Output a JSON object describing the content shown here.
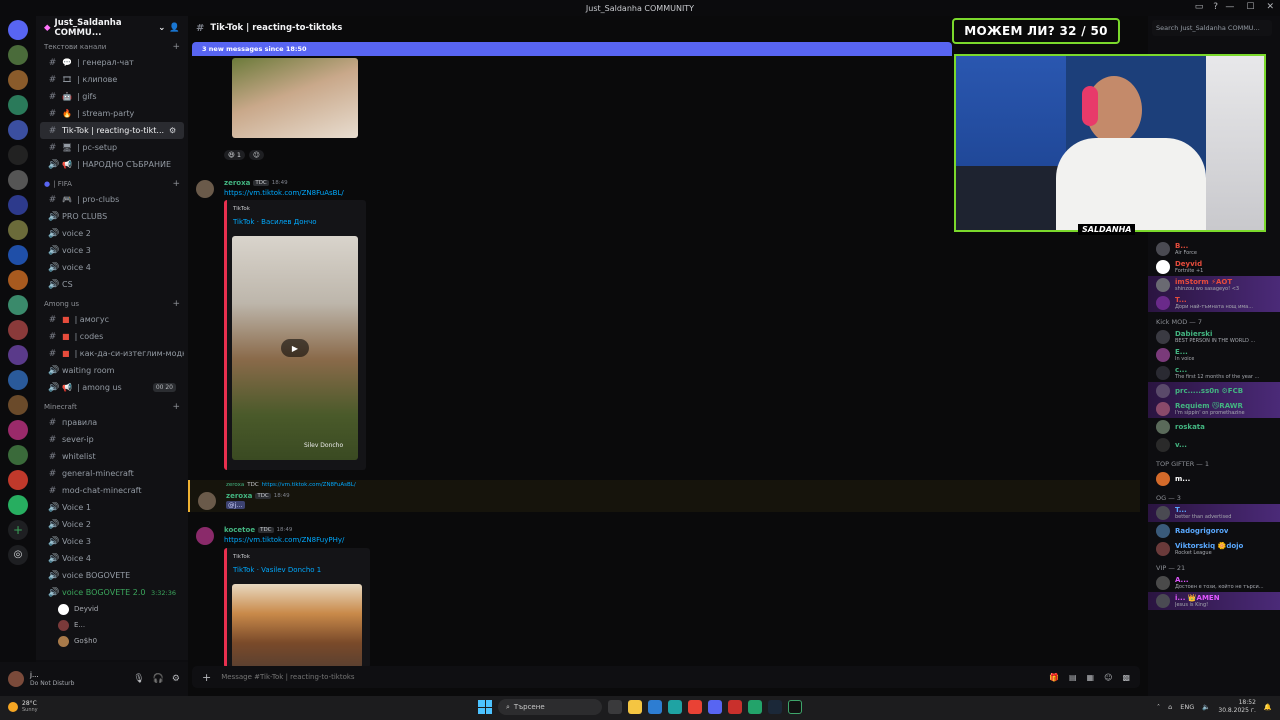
{
  "window": {
    "title": "Just_Saldanha COMMUNITY"
  },
  "server": {
    "name": "Just_Saldanha COMMU..."
  },
  "sidebar": {
    "categories": {
      "text": "Текстови канали",
      "fifa": "| FIFA",
      "among": "Among us",
      "minecraft": "Minecraft"
    },
    "channels_text": [
      "| генерал-чат",
      "| клипове",
      "| gifs",
      "| stream-party",
      "Tik-Tok | reacting-to-tikt...",
      "| pc-setup",
      "| НАРОДНО СЪБРАНИЕ"
    ],
    "channels_fifa": [
      "| pro-clubs",
      "PRO CLUBS",
      "voice 2",
      "voice 3",
      "voice 4",
      "CS"
    ],
    "channels_among": [
      "| амогус",
      "| codes",
      "| как-да-си-изтеглим-модн...",
      "waiting room",
      "| among us"
    ],
    "among_badge": "00 20",
    "channels_minecraft": [
      "правила",
      "sever-ip",
      "whitelist",
      "general-minecraft",
      "mod-chat-minecraft",
      "Voice 1",
      "Voice 2",
      "Voice 3",
      "Voice 4",
      "voice BOGOVETE",
      "voice BOGOVETE 2.0"
    ],
    "voice_timer": "3:32:36",
    "voice_users": [
      "Deyvid",
      "E...",
      "Go$h0"
    ]
  },
  "user": {
    "name": "j...",
    "status": "Do Not Disturb"
  },
  "channel": {
    "name": "Tik-Tok | reacting-to-tiktoks"
  },
  "new_messages": "3 new messages since 18:50",
  "messages": {
    "reaction_count": "1",
    "m1": {
      "author": "zeroxa",
      "tag": "TDC",
      "time": "18:49",
      "link": "https://vm.tiktok.com/ZN8FuAsBL/",
      "provider": "TikTok",
      "title": "TikTok · Василев Дончо",
      "watermark": "Silev Doncho"
    },
    "reply": {
      "ref_author": "zeroxa",
      "ref_tag": "TDC",
      "ref_link": "https://vm.tiktok.com/ZN8FuAsBL/",
      "author": "zeroxa",
      "tag": "TDC",
      "time": "18:49",
      "text": "@j..."
    },
    "m2": {
      "author": "kocetoe",
      "tag": "TDC",
      "time": "18:49",
      "link": "https://vm.tiktok.com/ZN8FuyPHy/",
      "provider": "TikTok",
      "title": "TikTok · Vasilev Doncho 1"
    }
  },
  "composer": {
    "placeholder": "Message #Tik-Tok | reacting-to-tiktoks"
  },
  "search": {
    "placeholder": "Search Just_Saldanha COMMU..."
  },
  "overlay": {
    "banner": "МОЖЕМ ЛИ? 32 / 50",
    "label": "SALDANHA"
  },
  "members": {
    "top": [
      {
        "name": "B...",
        "activity": "Air Force",
        "color": "#e74c3c"
      },
      {
        "name": "Deyvid",
        "activity": "Fortnite +1",
        "color": "#e74c3c"
      },
      {
        "name": "imStorm ⚡AOT",
        "activity": "shinzou wo sasageyo! <3",
        "color": "#e74c3c"
      },
      {
        "name": "T...",
        "activity": "Дори най-тъмната нощ има...",
        "color": "#e74c3c"
      }
    ],
    "kick_mod_title": "Kick MOD — 7",
    "kick_mod": [
      {
        "name": "Dabierski",
        "activity": "BEST PERSON IN THE WORLD ...",
        "color": "#43b581"
      },
      {
        "name": "E...",
        "activity": "In voice",
        "color": "#43b581"
      },
      {
        "name": "c...",
        "activity": "The first 12 months of the year ...",
        "color": "#43b581"
      },
      {
        "name": "prc.....ss0n ⚙FCB",
        "activity": "",
        "color": "#43b581"
      },
      {
        "name": "Requiem 😼RAWR",
        "activity": "I'm sippin' on promethazine",
        "color": "#43b581"
      },
      {
        "name": "roskata",
        "activity": "",
        "color": "#43b581"
      },
      {
        "name": "v...",
        "activity": "",
        "color": "#43b581"
      }
    ],
    "top_gifter_title": "TOP GIFTER — 1",
    "top_gifter": [
      {
        "name": "m...",
        "activity": "",
        "color": "#ffffff"
      }
    ],
    "og_title": "OG — 3",
    "og": [
      {
        "name": "T...",
        "activity": "better than advertised",
        "color": "#5aa9ff"
      },
      {
        "name": "Radogrigorov",
        "activity": "",
        "color": "#5aa9ff"
      },
      {
        "name": "Viktorskiq 🌼dojo",
        "activity": "Rocket League",
        "color": "#5aa9ff"
      }
    ],
    "vip_title": "VIP — 21",
    "vip": [
      {
        "name": "A...",
        "activity": "Достоен е този, който не търси...",
        "color": "#e056fd"
      },
      {
        "name": "i... 👑AMEN",
        "activity": "Jesus is King!",
        "color": "#e056fd"
      }
    ]
  },
  "taskbar": {
    "weather_temp": "28°C",
    "weather_cond": "Sunny",
    "search": "Търсене",
    "lang": "ENG",
    "time": "18:52",
    "date": "30.8.2025 г."
  }
}
